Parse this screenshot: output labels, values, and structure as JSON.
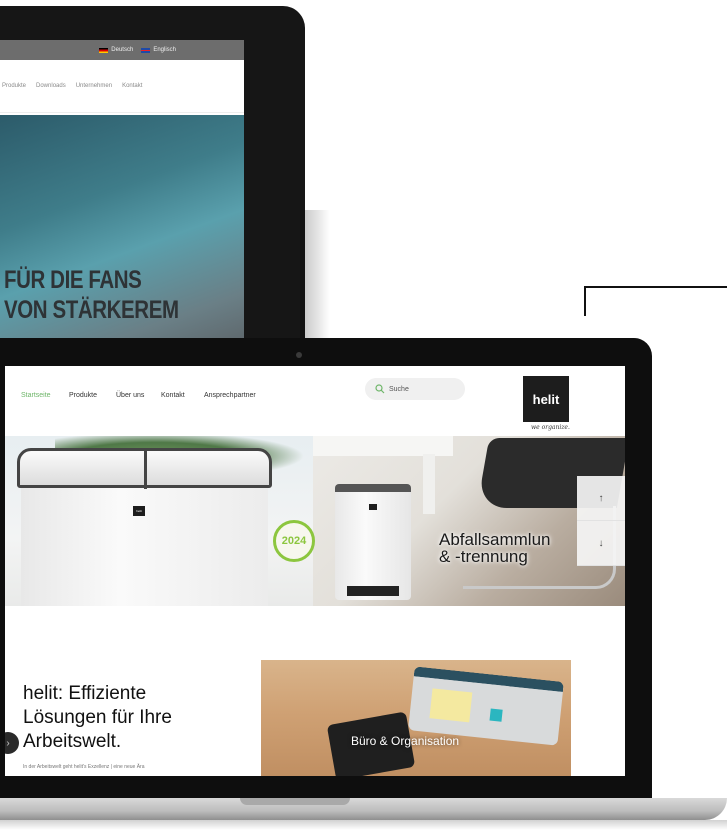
{
  "back_laptop": {
    "languages": [
      "Deutsch",
      "Englisch"
    ],
    "nav": [
      "Produkte",
      "Downloads",
      "Unternehmen",
      "Kontakt"
    ],
    "hero_lines": [
      "FÜR DIE FANS",
      "VON STÄRKEREM"
    ]
  },
  "front_laptop": {
    "nav": [
      "Startseite",
      "Produkte",
      "Über uns",
      "Kontakt",
      "Ansprechpartner"
    ],
    "search_placeholder": "Suche",
    "logo_text": "helit",
    "logo_tagline": "we organize.",
    "bin_label": "helit",
    "badge_year": "2024",
    "hero_caption_lines": [
      "Abfallsammlun",
      "& -trennung"
    ],
    "scroll_up": "↑",
    "scroll_down": "↓",
    "headline_lines": [
      "helit: Effiziente",
      "Lösungen für Ihre",
      "Arbeitswelt."
    ],
    "body_snippet": "In der Arbeitswelt geht helit's Exzellenz | eine neue Ära",
    "tile_label": "Büro & Organisation",
    "side_button": "›"
  },
  "colors": {
    "accent_green": "#6fb66a",
    "logo_bg": "#1d1d1d",
    "badge_green": "#8cc63f"
  }
}
